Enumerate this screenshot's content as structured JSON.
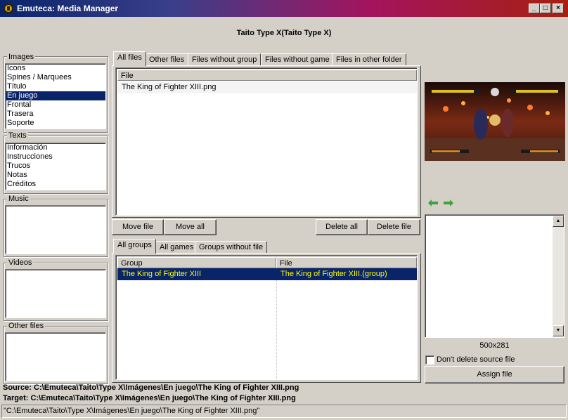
{
  "window": {
    "title": "Emuteca: Media Manager",
    "icon": "emuteca-app-icon",
    "controls": {
      "minimize": "_",
      "maximize": "□",
      "close": "×"
    }
  },
  "heading": "Taito Type X(Taito Type X)",
  "images": {
    "label": "Images",
    "items": [
      "Icons",
      "Spines / Marquees",
      "Título",
      "En juego",
      "Frontal",
      "Trasera",
      "Soporte"
    ],
    "selected_index": 3
  },
  "texts": {
    "label": "Texts",
    "items": [
      "Información",
      "Instrucciones",
      "Trucos",
      "Notas",
      "Créditos"
    ]
  },
  "music": {
    "label": "Music"
  },
  "videos": {
    "label": "Videos"
  },
  "other_files": {
    "label": "Other files"
  },
  "file_tabs": [
    "All files",
    "Other files",
    "Files without group",
    "Files without game",
    "Files in other folder"
  ],
  "files_grid": {
    "column": "File",
    "rows": [
      "The King of Fighter XIII.png"
    ]
  },
  "file_buttons": {
    "move_file": "Move file",
    "move_all": "Move all",
    "delete_all": "Delete all",
    "delete_file": "Delete file"
  },
  "group_tabs": [
    "All groups",
    "All games",
    "Groups without file"
  ],
  "groups_grid": {
    "columns": [
      "Group",
      "File"
    ],
    "rows": [
      {
        "group": "The King of Fighter XIII",
        "file": "The King of Fighter XIII.(group)"
      }
    ]
  },
  "preview": {
    "nav_prev_icon": "arrow-left-icon",
    "nav_next_icon": "arrow-right-icon",
    "dimensions": "500x281"
  },
  "options": {
    "dont_delete_label": "Don't delete source file",
    "dont_delete_checked": false,
    "assign_file": "Assign file"
  },
  "source": {
    "label": "Source:",
    "path": "C:\\Emuteca\\Taito\\Type X\\Imágenes\\En juego\\The King of Fighter XIII.png"
  },
  "target": {
    "label": "Target:",
    "path": "C:\\Emuteca\\Taito\\Type X\\Imágenes\\En juego\\The King of Fighter XIII.png"
  },
  "status": "\"C:\\Emuteca\\Taito\\Type X\\Imágenes\\En juego\\The King of Fighter XIII.png\"",
  "colors": {
    "selection": "#0a246a",
    "selection_text_group": "#ffff00",
    "face": "#d4d0c8",
    "arrow": "#3aa43a"
  }
}
